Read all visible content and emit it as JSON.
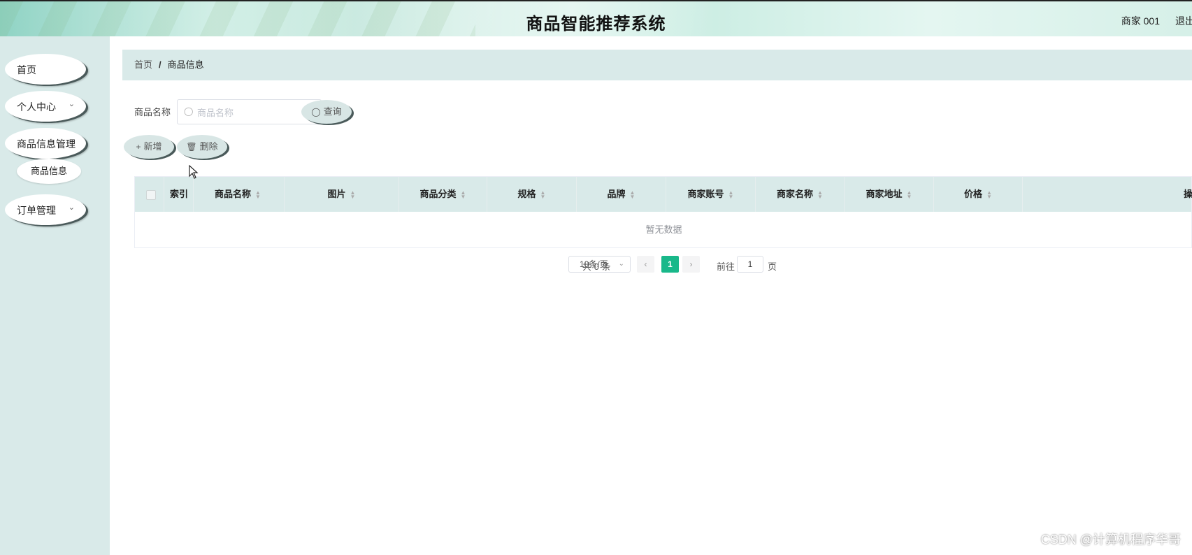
{
  "header": {
    "title": "商品智能推荐系统",
    "user": "商家 001",
    "logout": "退出"
  },
  "sidebar": {
    "items": [
      {
        "label": "首页"
      },
      {
        "label": "个人中心",
        "chevron": "chevron-down-icon"
      },
      {
        "label": "商品信息管理",
        "chevron": "chevron-down-icon"
      },
      {
        "label": "商品信息"
      },
      {
        "label": "订单管理",
        "chevron": "chevron-down-icon"
      }
    ]
  },
  "breadcrumb": {
    "home": "首页",
    "separator": "/",
    "current": "商品信息"
  },
  "search": {
    "label": "商品名称",
    "placeholder": "商品名称",
    "value": "",
    "button": "查询"
  },
  "actions": {
    "add": "新增",
    "delete": "删除"
  },
  "table": {
    "columns": [
      "索引",
      "商品名称",
      "图片",
      "商品分类",
      "规格",
      "品牌",
      "商家账号",
      "商家名称",
      "商家地址",
      "价格",
      "操"
    ],
    "empty_text": "暂无数据"
  },
  "pagination": {
    "total": "共 0 条",
    "page_size": "10条/页",
    "current_page": "1",
    "goto_label": "前往",
    "goto_value": "1",
    "page_suffix": "页"
  },
  "watermark": "CSDN @计算机程序华哥",
  "colors": {
    "accent": "#19b88a",
    "sidebar_bg": "#d9eae9",
    "button_bg": "#d8e6e5"
  }
}
